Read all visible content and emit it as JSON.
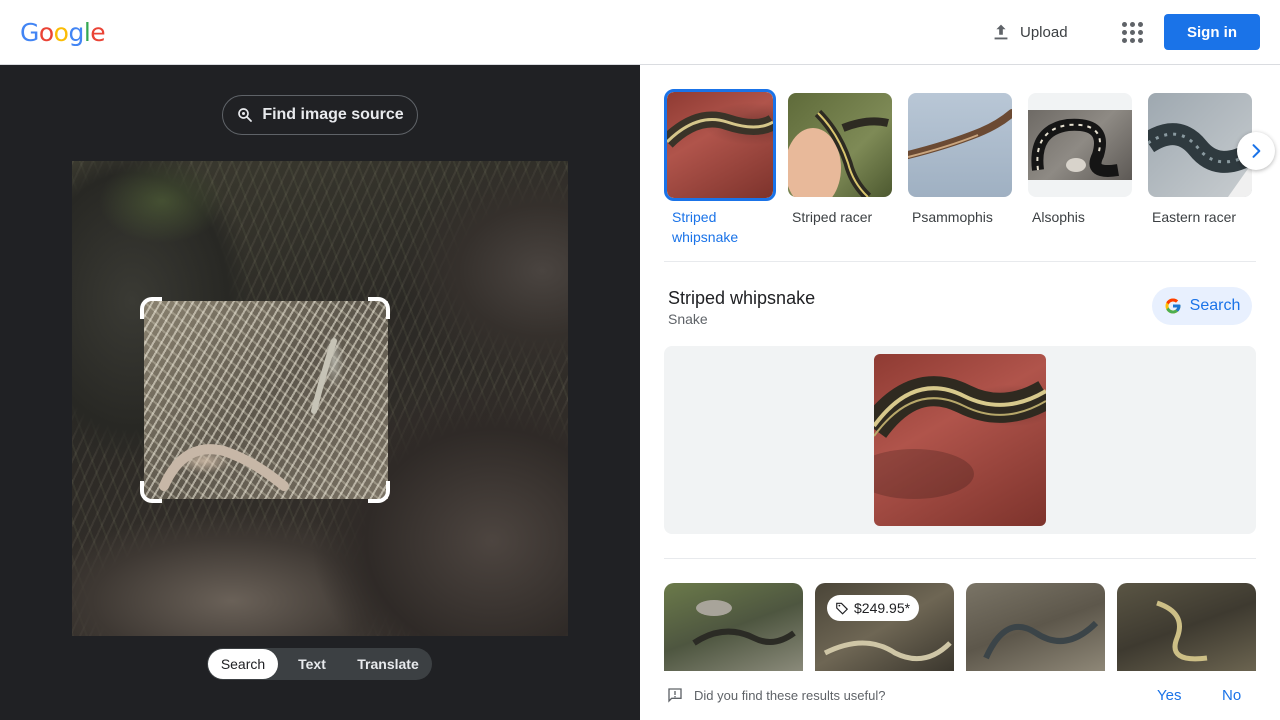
{
  "header": {
    "logo": [
      "G",
      "o",
      "o",
      "g",
      "l",
      "e"
    ],
    "logo_colors": [
      "#4285F4",
      "#EA4335",
      "#FBBC05",
      "#4285F4",
      "#34A853",
      "#EA4335"
    ],
    "upload_label": "Upload",
    "signin_label": "Sign in"
  },
  "left": {
    "find_source_label": "Find image source",
    "modes": [
      "Search",
      "Text",
      "Translate"
    ],
    "active_mode": "Search"
  },
  "results": {
    "chips": [
      {
        "label": "Striped whipsnake",
        "active": true
      },
      {
        "label": "Striped racer",
        "active": false
      },
      {
        "label": "Psammophis",
        "active": false
      },
      {
        "label": "Alsophis",
        "active": false
      },
      {
        "label": "Eastern racer",
        "active": false
      }
    ],
    "knowledge": {
      "title": "Striped whipsnake",
      "subtitle": "Snake",
      "search_label": "Search"
    },
    "grid": {
      "price": "$249.95*"
    },
    "feedback": {
      "question": "Did you find these results useful?",
      "yes": "Yes",
      "no": "No"
    }
  },
  "colors": {
    "accent": "#1a73e8",
    "dark_bg": "#202124"
  }
}
